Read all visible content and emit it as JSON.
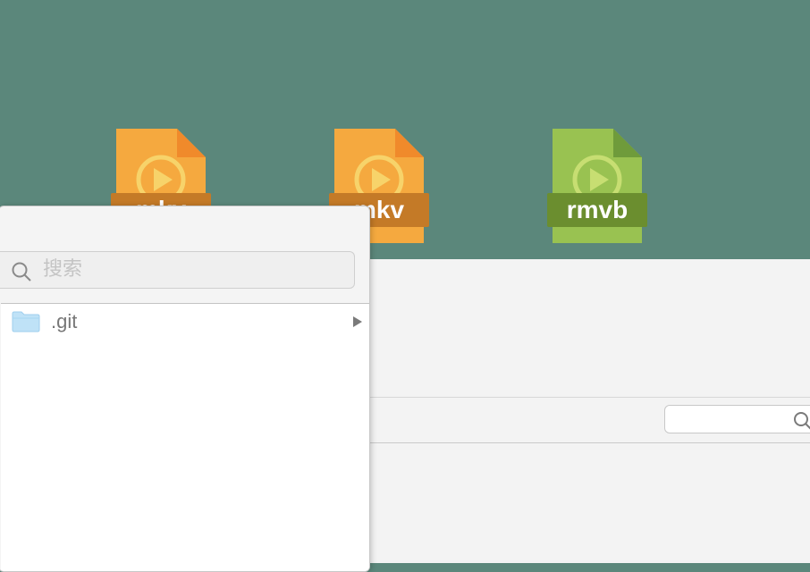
{
  "desktop": {
    "background": "#5b877b",
    "files": [
      {
        "ext": "mkv",
        "color": "#f5a93f",
        "fold": "#f08a2b",
        "band": "#c47a27",
        "icon": "video-file-icon"
      },
      {
        "ext": "mkv",
        "color": "#f5a93f",
        "fold": "#f08a2b",
        "band": "#c47a27",
        "icon": "video-file-icon"
      },
      {
        "ext": "rmvb",
        "color": "#99c251",
        "fold": "#6f9b3b",
        "band": "#6b8e2f",
        "icon": "video-file-icon"
      }
    ]
  },
  "front_panel": {
    "search": {
      "placeholder": "搜索",
      "icon": "search-icon"
    },
    "list": [
      {
        "label": ".git",
        "icon": "folder-icon",
        "chevron": "chevron-right-icon"
      }
    ]
  },
  "back_window": {
    "search": {
      "value": "",
      "icon": "search-icon"
    }
  }
}
